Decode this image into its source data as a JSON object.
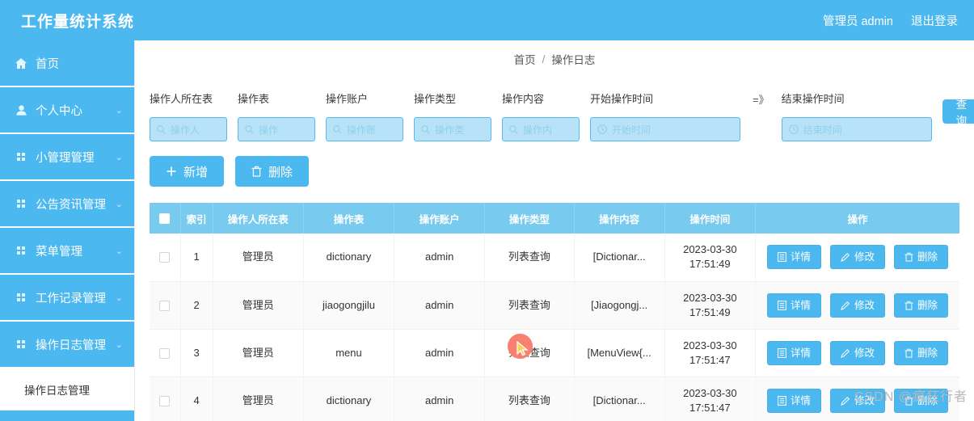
{
  "header": {
    "brand": "工作量统计系统",
    "user": "管理员 admin",
    "logout": "退出登录"
  },
  "sidebar": {
    "items": [
      {
        "label": "首页",
        "icon": "home-icon",
        "expandable": false
      },
      {
        "label": "个人中心",
        "icon": "user-icon",
        "expandable": true
      },
      {
        "label": "小管理管理",
        "icon": "grid-icon",
        "expandable": true
      },
      {
        "label": "公告资讯管理",
        "icon": "grid-icon",
        "expandable": true
      },
      {
        "label": "菜单管理",
        "icon": "grid-icon",
        "expandable": true
      },
      {
        "label": "工作记录管理",
        "icon": "grid-icon",
        "expandable": true
      },
      {
        "label": "操作日志管理",
        "icon": "grid-icon",
        "expandable": true
      }
    ],
    "sub_item": "操作日志管理",
    "chevron": "⌄"
  },
  "breadcrumb": {
    "root": "首页",
    "separator": "/",
    "current": "操作日志"
  },
  "filters": {
    "fields": [
      {
        "label": "操作人所在表",
        "placeholder": "操作人",
        "icon": "search-icon",
        "wide": false
      },
      {
        "label": "操作表",
        "placeholder": "操作",
        "icon": "search-icon",
        "wide": false
      },
      {
        "label": "操作账户",
        "placeholder": "操作账",
        "icon": "search-icon",
        "wide": false
      },
      {
        "label": "操作类型",
        "placeholder": "操作类",
        "icon": "search-icon",
        "wide": false
      },
      {
        "label": "操作内容",
        "placeholder": "操作内",
        "icon": "search-icon",
        "wide": false
      },
      {
        "label": "开始操作时间",
        "placeholder": "开始时间",
        "icon": "clock-icon",
        "wide": true
      },
      {
        "label": "结束操作时间",
        "placeholder": "结束时间",
        "icon": "clock-icon",
        "wide": true
      }
    ],
    "range_arrow": "=》",
    "query_button": "查询"
  },
  "toolbar": {
    "add_label": "新增",
    "add_icon": "plus-icon",
    "delete_label": "删除",
    "delete_icon": "trash-icon"
  },
  "table": {
    "columns": [
      "",
      "索引",
      "操作人所在表",
      "操作表",
      "操作账户",
      "操作类型",
      "操作内容",
      "操作时间",
      "操作"
    ],
    "row_buttons": [
      {
        "label": "详情",
        "icon": "document-icon"
      },
      {
        "label": "修改",
        "icon": "pencil-icon"
      },
      {
        "label": "删除",
        "icon": "trash-icon"
      }
    ],
    "rows": [
      {
        "index": "1",
        "operator_table": "管理员",
        "op_table": "dictionary",
        "account": "admin",
        "op_type": "列表查询",
        "op_content": "[Dictionar...",
        "op_time": "2023-03-30 17:51:49"
      },
      {
        "index": "2",
        "operator_table": "管理员",
        "op_table": "jiaogongjilu",
        "account": "admin",
        "op_type": "列表查询",
        "op_content": "[Jiaogongj...",
        "op_time": "2023-03-30 17:51:49"
      },
      {
        "index": "3",
        "operator_table": "管理员",
        "op_table": "menu",
        "account": "admin",
        "op_type": "列表查询",
        "op_content": "[MenuView{...",
        "op_time": "2023-03-30 17:51:47"
      },
      {
        "index": "4",
        "operator_table": "管理员",
        "op_table": "dictionary",
        "account": "admin",
        "op_type": "列表查询",
        "op_content": "[Dictionar...",
        "op_time": "2023-03-30 17:51:47"
      }
    ]
  },
  "watermark": "CSDN @疯狂行者",
  "colors": {
    "brand_blue": "#4cb8f0",
    "table_header_blue": "#78cbee",
    "input_fill": "#b7e2f8",
    "cursor": "#f98070"
  }
}
